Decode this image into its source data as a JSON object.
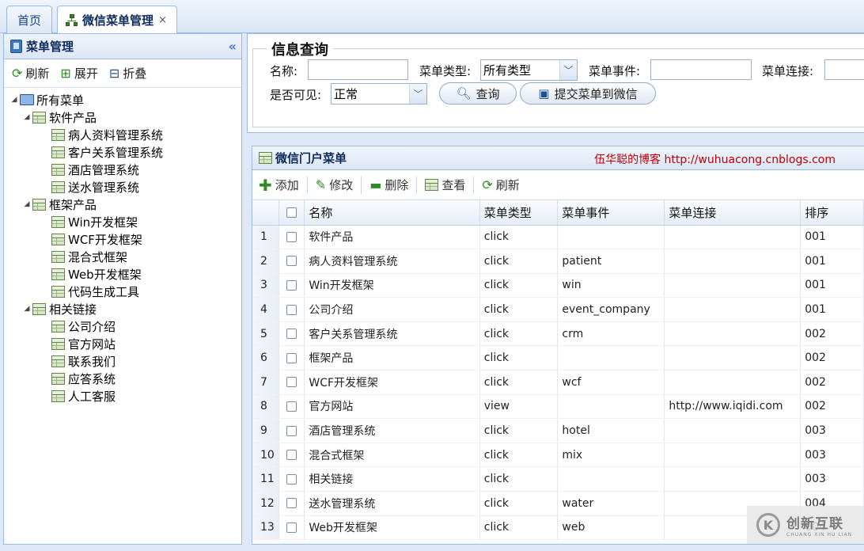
{
  "tabs": {
    "home": "首页",
    "wechat_menu": "微信菜单管理",
    "close": "×"
  },
  "left": {
    "title": "菜单管理",
    "collapse": "«",
    "toolbar": {
      "refresh": "刷新",
      "expand": "展开",
      "fold": "折叠"
    },
    "tree": {
      "root": "所有菜单",
      "groups": [
        {
          "label": "软件产品",
          "items": [
            "病人资料管理系统",
            "客户关系管理系统",
            "酒店管理系统",
            "送水管理系统"
          ]
        },
        {
          "label": "框架产品",
          "items": [
            "Win开发框架",
            "WCF开发框架",
            "混合式框架",
            "Web开发框架",
            "代码生成工具"
          ]
        },
        {
          "label": "相关链接",
          "items": [
            "公司介绍",
            "官方网站",
            "联系我们",
            "应答系统",
            "人工客服"
          ]
        }
      ]
    }
  },
  "search": {
    "legend": "信息查询",
    "name_label": "名称:",
    "type_label": "菜单类型:",
    "type_value": "所有类型",
    "event_label": "菜单事件:",
    "link_label": "菜单连接:",
    "visible_label": "是否可见:",
    "visible_value": "正常",
    "query_btn": "查询",
    "submit_btn": "提交菜单到微信"
  },
  "grid": {
    "title": "微信门户菜单",
    "blog": "伍华聪的博客 http://wuhuacong.cnblogs.com",
    "toolbar": {
      "add": "添加",
      "edit": "修改",
      "delete": "删除",
      "view": "查看",
      "refresh": "刷新"
    },
    "columns": {
      "name": "名称",
      "type": "菜单类型",
      "event": "菜单事件",
      "link": "菜单连接",
      "order": "排序"
    },
    "rows": [
      {
        "no": "1",
        "name": "软件产品",
        "type": "click",
        "event": "",
        "link": "",
        "order": "001"
      },
      {
        "no": "2",
        "name": "病人资料管理系统",
        "type": "click",
        "event": "patient",
        "link": "",
        "order": "001"
      },
      {
        "no": "3",
        "name": "Win开发框架",
        "type": "click",
        "event": "win",
        "link": "",
        "order": "001"
      },
      {
        "no": "4",
        "name": "公司介绍",
        "type": "click",
        "event": "event_company",
        "link": "",
        "order": "001"
      },
      {
        "no": "5",
        "name": "客户关系管理系统",
        "type": "click",
        "event": "crm",
        "link": "",
        "order": "002"
      },
      {
        "no": "6",
        "name": "框架产品",
        "type": "click",
        "event": "",
        "link": "",
        "order": "002"
      },
      {
        "no": "7",
        "name": "WCF开发框架",
        "type": "click",
        "event": "wcf",
        "link": "",
        "order": "002"
      },
      {
        "no": "8",
        "name": "官方网站",
        "type": "view",
        "event": "",
        "link": "http://www.iqidi.com",
        "order": "002"
      },
      {
        "no": "9",
        "name": "酒店管理系统",
        "type": "click",
        "event": "hotel",
        "link": "",
        "order": "003"
      },
      {
        "no": "10",
        "name": "混合式框架",
        "type": "click",
        "event": "mix",
        "link": "",
        "order": "003"
      },
      {
        "no": "11",
        "name": "相关链接",
        "type": "click",
        "event": "",
        "link": "",
        "order": "003"
      },
      {
        "no": "12",
        "name": "送水管理系统",
        "type": "click",
        "event": "water",
        "link": "",
        "order": "004"
      },
      {
        "no": "13",
        "name": "Web开发框架",
        "type": "click",
        "event": "web",
        "link": "",
        "order": "004"
      }
    ]
  },
  "watermark": {
    "cn": "创新互联",
    "en": "CHUANG XIN HU LIAN",
    "logo": "K"
  }
}
